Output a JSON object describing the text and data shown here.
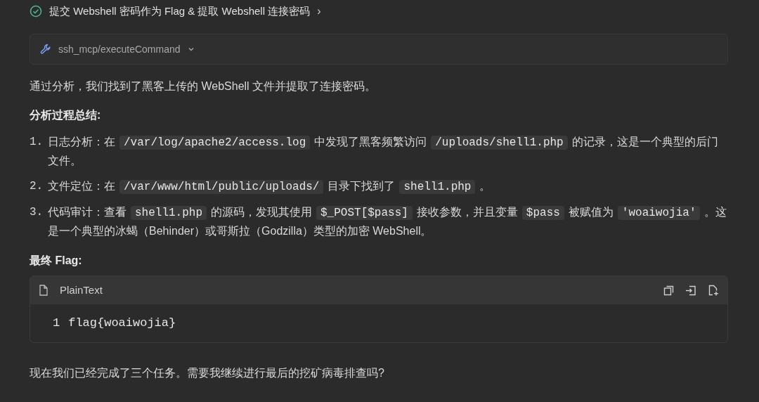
{
  "step": {
    "title": "提交 Webshell 密码作为 Flag & 提取 Webshell 连接密码",
    "chevron": "›"
  },
  "tool_call": {
    "label": "ssh_mcp/executeCommand"
  },
  "intro": "通过分析，我们找到了黑客上传的 WebShell 文件并提取了连接密码。",
  "summary_heading": "分析过程总结:",
  "steps": [
    {
      "number": "1.",
      "segments": [
        {
          "kind": "text",
          "text": "日志分析：在"
        },
        {
          "kind": "code",
          "text": "/var/log/apache2/access.log"
        },
        {
          "kind": "text",
          "text": "中发现了黑客频繁访问"
        },
        {
          "kind": "code",
          "text": "/uploads/shell1.php"
        },
        {
          "kind": "text",
          "text": "的记录，这是一个典型的后门文件。"
        }
      ]
    },
    {
      "number": "2.",
      "segments": [
        {
          "kind": "text",
          "text": "文件定位：在"
        },
        {
          "kind": "code",
          "text": "/var/www/html/public/uploads/"
        },
        {
          "kind": "text",
          "text": "目录下找到了"
        },
        {
          "kind": "code",
          "text": "shell1.php"
        },
        {
          "kind": "text",
          "text": "。"
        }
      ]
    },
    {
      "number": "3.",
      "segments": [
        {
          "kind": "text",
          "text": "代码审计：查看"
        },
        {
          "kind": "code",
          "text": "shell1.php"
        },
        {
          "kind": "text",
          "text": "的源码，发现其使用"
        },
        {
          "kind": "code",
          "text": "$_POST[$pass]"
        },
        {
          "kind": "text",
          "text": "接收参数，并且变量"
        },
        {
          "kind": "code",
          "text": "$pass"
        },
        {
          "kind": "text",
          "text": "被赋值为"
        },
        {
          "kind": "code",
          "text": "'woaiwojia'"
        },
        {
          "kind": "text",
          "text": "。这是一个典型的冰蝎（Behinder）或哥斯拉（Godzilla）类型的加密 WebShell。"
        }
      ]
    }
  ],
  "flag_heading": "最终 Flag:",
  "code_block": {
    "language": "PlainText",
    "lines": [
      {
        "number": "1",
        "text": "flag{woaiwojia}"
      }
    ]
  },
  "closing": "现在我们已经完成了三个任务。需要我继续进行最后的挖矿病毒排查吗?"
}
